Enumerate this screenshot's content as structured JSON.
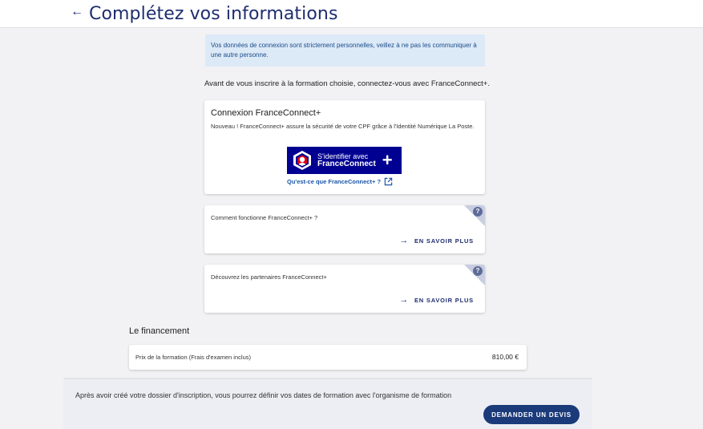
{
  "header": {
    "back_icon": "←",
    "title": "Complétez vos informations"
  },
  "banner": {
    "text": "Vos données de connexion sont strictement personnelles, veillez à ne pas les communiquer à une autre personne."
  },
  "intro": "Avant de vous inscrire à la formation choisie, connectez-vous avec FranceConnect+.",
  "franceconnect_card": {
    "title": "Connexion FranceConnect+",
    "description": "Nouveau ! FranceConnect+ assure la sécurité de votre CPF grâce à l'Identité Numérique La Poste.",
    "button_line1": "S'identifier avec",
    "button_line2": "FranceConnect",
    "button_plus": "+",
    "button_color": "#000091",
    "link_label": "Qu'est-ce que FranceConnect+ ?"
  },
  "help_cards": [
    {
      "text": "Comment fonctionne FranceConnect+ ?",
      "link_label": "EN SAVOIR PLUS",
      "badge": "?"
    },
    {
      "text": "Découvrez les partenaires FranceConnect+",
      "link_label": "EN SAVOIR PLUS",
      "badge": "?"
    }
  ],
  "financement": {
    "title": "Le financement",
    "price_label": "Prix de la formation (Frais d'examen inclus)",
    "price_value": "810,00 €"
  },
  "footer": {
    "text": "Après avoir créé votre dossier d'inscription, vous pourrez définir vos dates de formation avec l'organisme de formation",
    "button_label": "DEMANDER UN DEVIS",
    "button_color": "#1a3a7a"
  },
  "icons": {
    "back": "arrow-left-icon",
    "external": "external-link-icon",
    "arrow_right": "arrow-right-icon",
    "help": "question-icon"
  }
}
